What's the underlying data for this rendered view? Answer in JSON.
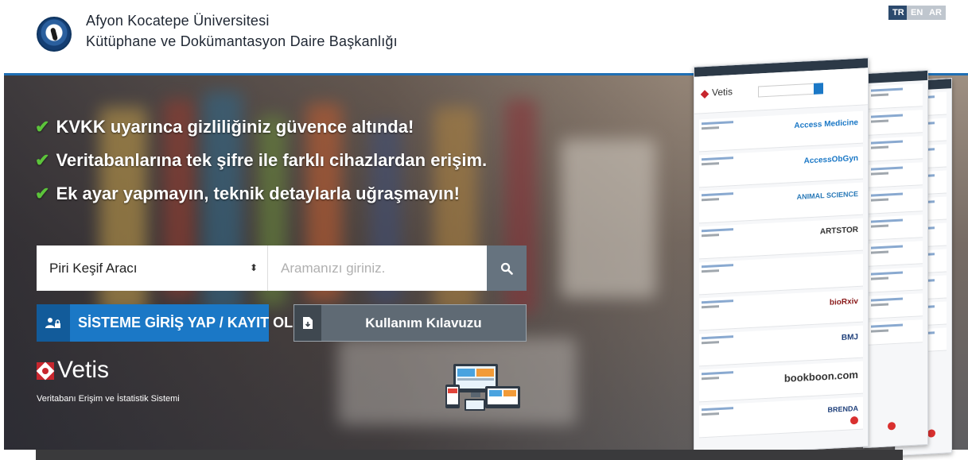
{
  "header": {
    "university": "Afyon Kocatepe Üniversitesi",
    "department": "Kütüphane ve Dokümantasyon Daire Başkanlığı",
    "languages": [
      "TR",
      "EN",
      "AR"
    ]
  },
  "features": [
    "KVKK uyarınca gizliliğiniz güvence altında!",
    "Veritabanlarına tek şifre ile farklı cihazlardan erişim.",
    "Ek ayar yapmayın, teknik detaylarla uğraşmayın!"
  ],
  "search": {
    "selected_tool": "Piri Keşif Aracı",
    "placeholder": "Aramanızı giriniz."
  },
  "buttons": {
    "login": "SİSTEME GİRİŞ YAP / KAYIT OL",
    "guide": "Kullanım Kılavuzu"
  },
  "vetis": {
    "name": "Vetis",
    "subtitle": "Veritabanı Erişim ve İstatistik Sistemi"
  },
  "preview": {
    "vendors": [
      "Access Medicine",
      "AccessObGyn",
      "ANIMAL SCIENCE",
      "ARTSTOR",
      "bioRxiv",
      "BMJ",
      "bookboon.com",
      "BRENDA"
    ]
  },
  "colors": {
    "primary": "#1b78c6",
    "dark": "#2c4a6d",
    "check": "#5cc43b",
    "vetis_red": "#c7262e"
  },
  "icons": {
    "search": "search-icon",
    "login": "users-lock-icon",
    "guide": "download-file-icon",
    "check": "check-icon"
  }
}
